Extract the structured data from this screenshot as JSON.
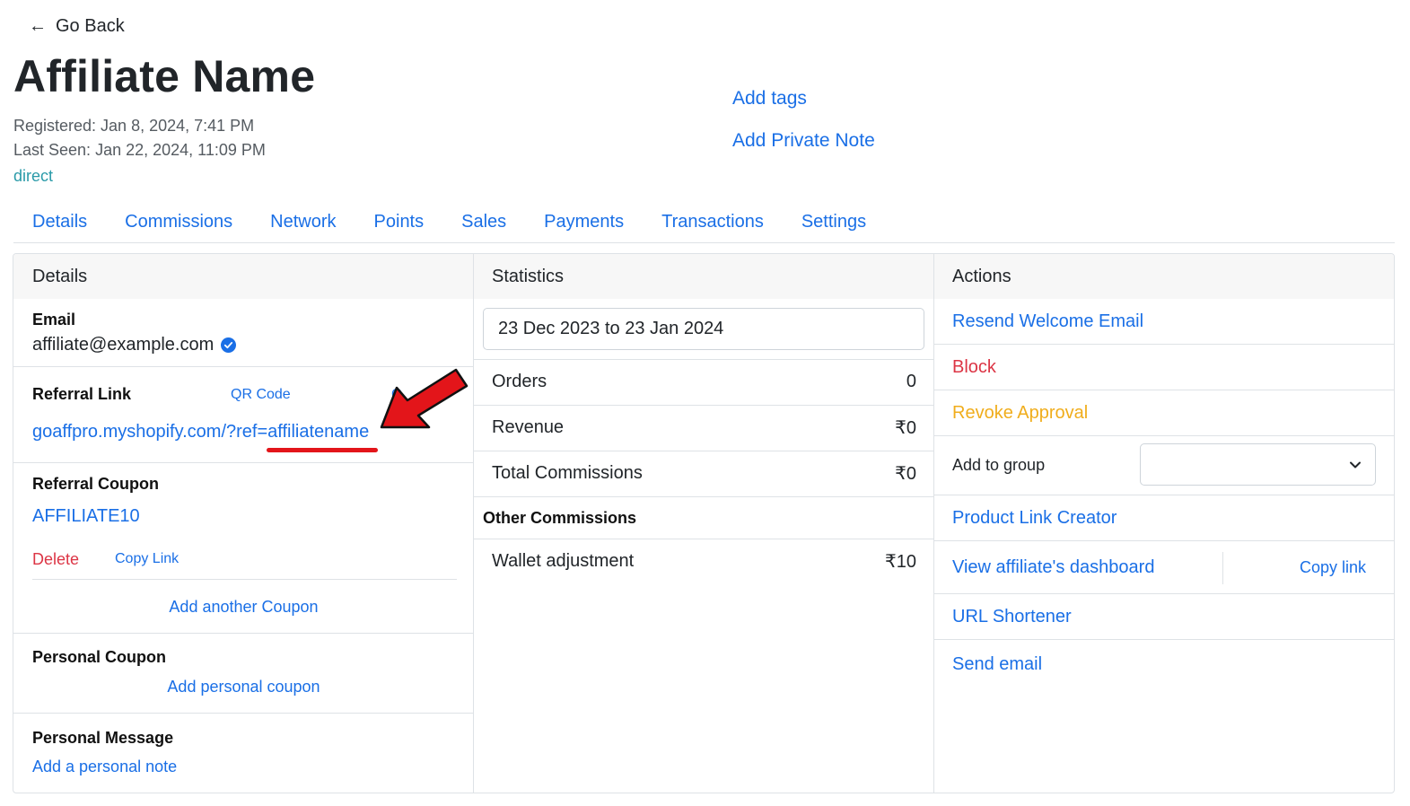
{
  "header": {
    "go_back": "Go Back",
    "title": "Affiliate Name",
    "registered": "Registered: Jan 8, 2024, 7:41 PM",
    "last_seen": "Last Seen: Jan 22, 2024, 11:09 PM",
    "source": "direct",
    "add_tags": "Add tags",
    "add_private_note": "Add Private Note"
  },
  "tabs": [
    {
      "label": "Details"
    },
    {
      "label": "Commissions"
    },
    {
      "label": "Network"
    },
    {
      "label": "Points"
    },
    {
      "label": "Sales"
    },
    {
      "label": "Payments"
    },
    {
      "label": "Transactions"
    },
    {
      "label": "Settings"
    }
  ],
  "details": {
    "heading": "Details",
    "email_label": "Email",
    "email_value": "affiliate@example.com",
    "referral_link_label": "Referral Link",
    "qr_code": "QR Code",
    "copy_partial": "C",
    "referral_link": "goaffpro.myshopify.com/?ref=affiliatename",
    "referral_coupon_label": "Referral Coupon",
    "coupon_code": "AFFILIATE10",
    "delete": "Delete",
    "copy_link": "Copy Link",
    "add_another_coupon": "Add another Coupon",
    "personal_coupon_label": "Personal Coupon",
    "add_personal_coupon": "Add personal coupon",
    "personal_message_label": "Personal Message",
    "add_personal_note": "Add a personal note"
  },
  "statistics": {
    "heading": "Statistics",
    "date_range": "23 Dec 2023 to 23 Jan 2024",
    "rows": [
      {
        "label": "Orders",
        "value": "0"
      },
      {
        "label": "Revenue",
        "value": "₹0"
      },
      {
        "label": "Total Commissions",
        "value": "₹0"
      }
    ],
    "other_heading": "Other Commissions",
    "other_rows": [
      {
        "label": "Wallet adjustment",
        "value": "₹10"
      }
    ]
  },
  "actions": {
    "heading": "Actions",
    "resend_welcome": "Resend Welcome Email",
    "block": "Block",
    "revoke_approval": "Revoke Approval",
    "add_to_group": "Add to group",
    "group_value": "",
    "product_link_creator": "Product Link Creator",
    "view_dashboard": "View affiliate's dashboard",
    "copy_link": "Copy link",
    "url_shortener": "URL Shortener",
    "send_email": "Send email"
  },
  "colors": {
    "link": "#1a6fe6",
    "danger": "#dc3545",
    "warning": "#f0ad1c",
    "annotation": "#e3151a"
  }
}
